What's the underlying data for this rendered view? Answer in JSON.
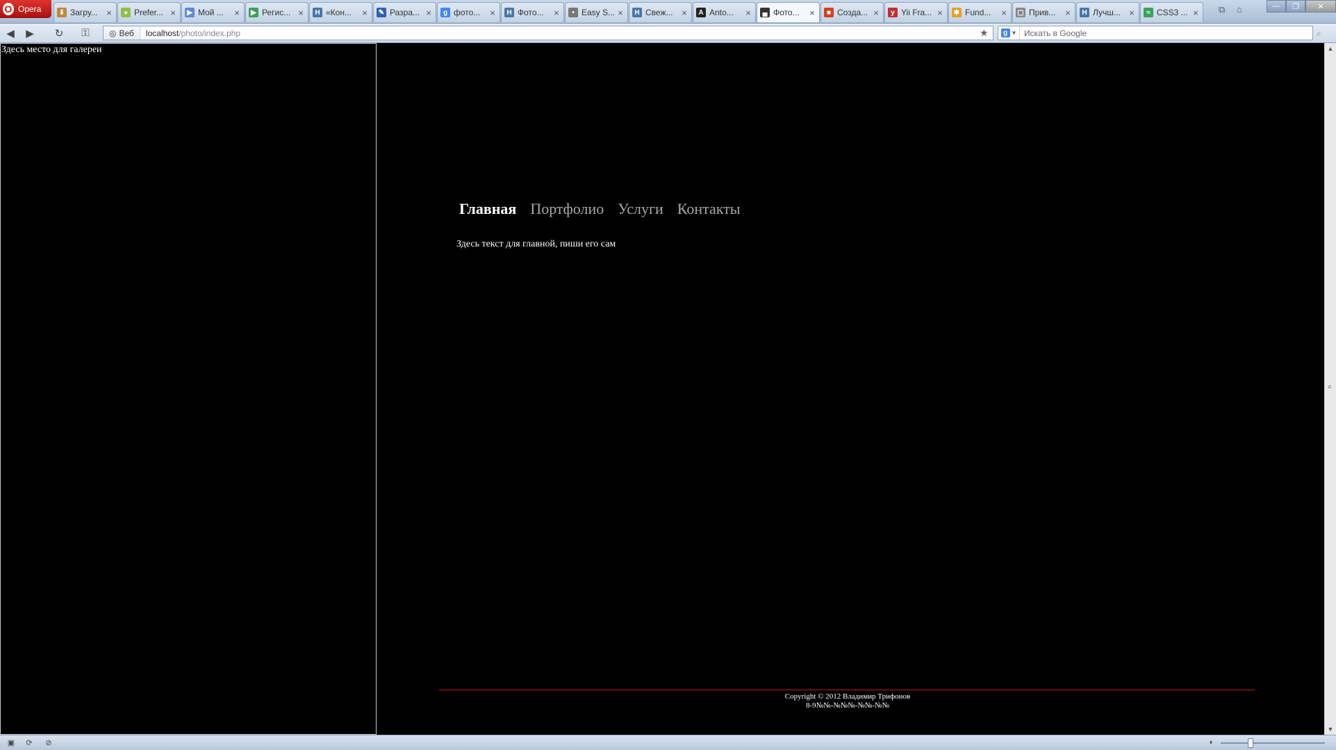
{
  "browser": {
    "menu_label": "Opera",
    "tabs": [
      {
        "title": "Загру...",
        "icon": "download-icon",
        "color": "#c0883a",
        "glyph": "⬇"
      },
      {
        "title": "Prefer...",
        "icon": "android-icon",
        "color": "#8fc046",
        "glyph": "●"
      },
      {
        "title": "Мой ...",
        "icon": "play-store-icon",
        "color": "#5a8ad8",
        "glyph": "▶"
      },
      {
        "title": "Регис...",
        "icon": "play-store-icon",
        "color": "#3aa35a",
        "glyph": "▶"
      },
      {
        "title": "«Кон...",
        "icon": "habr-icon",
        "color": "#4a76a8",
        "glyph": "H"
      },
      {
        "title": "Разра...",
        "icon": "pencil-icon",
        "color": "#3060b0",
        "glyph": "✎"
      },
      {
        "title": "фото...",
        "icon": "google-icon",
        "color": "#4285f4",
        "glyph": "g"
      },
      {
        "title": "Фото...",
        "icon": "habr-icon",
        "color": "#4a76a8",
        "glyph": "H"
      },
      {
        "title": "Easy S...",
        "icon": "page-icon",
        "color": "#777777",
        "glyph": "•"
      },
      {
        "title": "Свеж...",
        "icon": "habr-icon",
        "color": "#4a76a8",
        "glyph": "H"
      },
      {
        "title": "Anto...",
        "icon": "a-letter-icon",
        "color": "#222222",
        "glyph": "A"
      },
      {
        "title": "Фото...",
        "icon": "local-page-icon",
        "color": "#333333",
        "glyph": "▄"
      },
      {
        "title": "Созда...",
        "icon": "windows-icon",
        "color": "#d64020",
        "glyph": "■"
      },
      {
        "title": "Yii Fra...",
        "icon": "yii-icon",
        "color": "#c03030",
        "glyph": "y"
      },
      {
        "title": "Fund...",
        "icon": "foundation-icon",
        "color": "#e8a020",
        "glyph": "✱"
      },
      {
        "title": "Прив...",
        "icon": "page-icon",
        "color": "#888888",
        "glyph": "▢"
      },
      {
        "title": "Лучш...",
        "icon": "habr-icon",
        "color": "#4a76a8",
        "glyph": "H"
      },
      {
        "title": "CSS3 ...",
        "icon": "css3-icon",
        "color": "#3aa35a",
        "glyph": "≈"
      }
    ],
    "active_tab_index": 11,
    "address": {
      "badge": "Веб",
      "host": "localhost",
      "path": "/photo/index.php"
    },
    "search": {
      "placeholder": "Искать в Google"
    }
  },
  "page": {
    "gallery_placeholder": "Здесь место для галереи",
    "nav": [
      {
        "label": "Главная",
        "active": true
      },
      {
        "label": "Портфолио",
        "active": false
      },
      {
        "label": "Услуги",
        "active": false
      },
      {
        "label": "Контакты",
        "active": false
      }
    ],
    "main_text": "Здесь текст для главной, пиши его сам",
    "footer": {
      "copyright": "Copyright © 2012 Владимир Трифонов",
      "phone": "8-9№№-№№№-№№-№№"
    }
  },
  "colors": {
    "background": "#000000",
    "footer_line": "#c01818",
    "nav_active": "#ffffff",
    "nav_inactive": "#a7a7a7"
  }
}
